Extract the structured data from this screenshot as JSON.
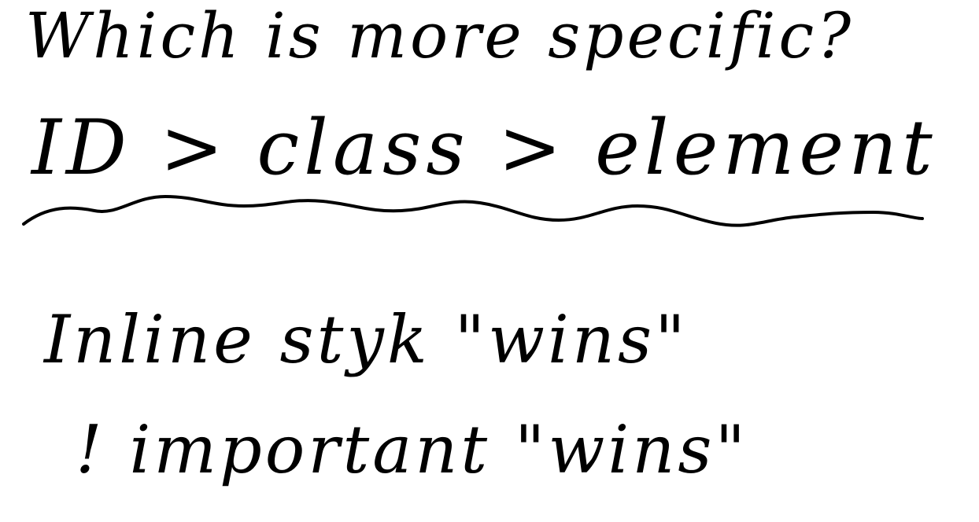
{
  "note": {
    "question": "Which is more specific?",
    "hierarchy": "ID > class > element",
    "inline_rule": "Inline styk \"wins\"",
    "important_rule": "! important \"wins\"",
    "ink_color": "#000000",
    "background_color": "#ffffff"
  }
}
